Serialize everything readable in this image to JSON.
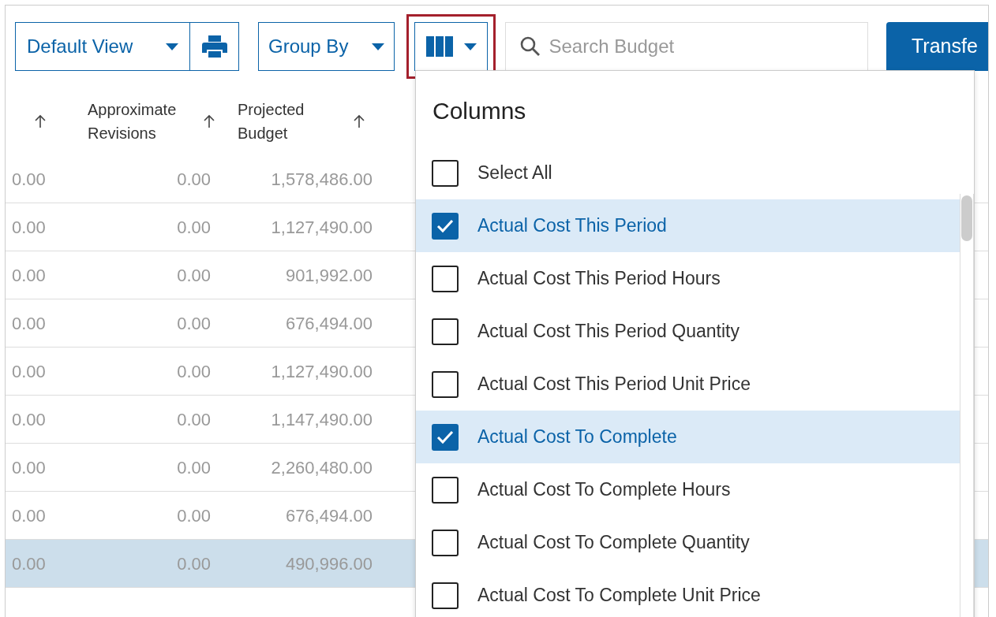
{
  "toolbar": {
    "view_button": "Default View",
    "group_button": "Group By",
    "columns_button": {
      "highlighted": true,
      "expanded": true
    },
    "search": {
      "placeholder": "Search Budget"
    },
    "transfer_button": "Transfe"
  },
  "table": {
    "columns": [
      {
        "sorted": true
      },
      {
        "label": "Approximate Revisions",
        "sorted": true
      },
      {
        "label": "Projected Budget",
        "sorted": true
      }
    ],
    "rows": [
      {
        "cells": [
          "0.00",
          "0.00",
          "1,578,486.00"
        ],
        "selected": false
      },
      {
        "cells": [
          "0.00",
          "0.00",
          "1,127,490.00"
        ],
        "selected": false
      },
      {
        "cells": [
          "0.00",
          "0.00",
          "901,992.00"
        ],
        "selected": false
      },
      {
        "cells": [
          "0.00",
          "0.00",
          "676,494.00"
        ],
        "selected": false
      },
      {
        "cells": [
          "0.00",
          "0.00",
          "1,127,490.00"
        ],
        "selected": false
      },
      {
        "cells": [
          "0.00",
          "0.00",
          "1,147,490.00"
        ],
        "selected": false
      },
      {
        "cells": [
          "0.00",
          "0.00",
          "2,260,480.00"
        ],
        "selected": false
      },
      {
        "cells": [
          "0.00",
          "0.00",
          "676,494.00"
        ],
        "selected": false
      },
      {
        "cells": [
          "0.00",
          "0.00",
          "490,996.00"
        ],
        "selected": true
      }
    ]
  },
  "columns_menu": {
    "title": "Columns",
    "items": [
      {
        "label": "Select All",
        "checked": false
      },
      {
        "label": "Actual Cost This Period",
        "checked": true
      },
      {
        "label": "Actual Cost This Period Hours",
        "checked": false
      },
      {
        "label": "Actual Cost This Period Quantity",
        "checked": false
      },
      {
        "label": "Actual Cost This Period Unit Price",
        "checked": false
      },
      {
        "label": "Actual Cost To Complete",
        "checked": true
      },
      {
        "label": "Actual Cost To Complete Hours",
        "checked": false
      },
      {
        "label": "Actual Cost To Complete Quantity",
        "checked": false
      },
      {
        "label": "Actual Cost To Complete Unit Price",
        "checked": false
      }
    ]
  }
}
